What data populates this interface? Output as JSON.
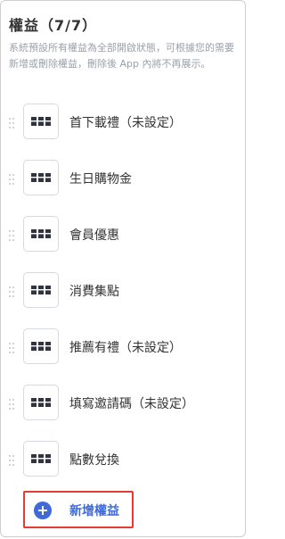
{
  "header": {
    "title": "權益（7/7）",
    "description": "系統預設所有權益為全部開啟狀態，可根據您的需要新增或刪除權益，刪除後 App 內將不再展示。"
  },
  "benefits": [
    {
      "label": "首下載禮（未設定）",
      "icon": "benefit-card-icon"
    },
    {
      "label": "生日購物金",
      "icon": "benefit-card-icon"
    },
    {
      "label": "會員優惠",
      "icon": "benefit-card-icon"
    },
    {
      "label": "消費集點",
      "icon": "benefit-card-icon"
    },
    {
      "label": "推薦有禮（未設定）",
      "icon": "benefit-card-icon"
    },
    {
      "label": "填寫邀請碼（未設定）",
      "icon": "benefit-card-icon"
    },
    {
      "label": "點數兌換",
      "icon": "benefit-card-icon"
    }
  ],
  "actions": {
    "add_label": "新增權益"
  },
  "colors": {
    "accent": "#3f6ad8",
    "highlight_border": "#e63a32",
    "muted_text": "#9aa1a9"
  }
}
